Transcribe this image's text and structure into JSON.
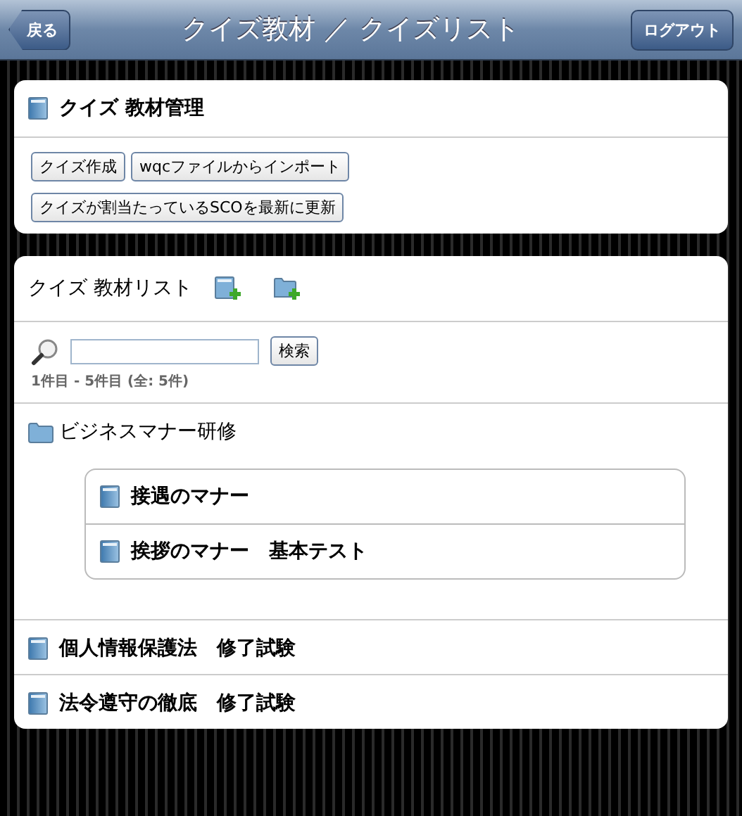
{
  "header": {
    "back": "戻る",
    "title": "クイズ教材 ／ クイズリスト",
    "logout": "ログアウト"
  },
  "management": {
    "title": "クイズ 教材管理",
    "buttons": [
      "クイズ作成",
      "wqcファイルからインポート",
      "クイズが割当たっているSCOを最新に更新"
    ]
  },
  "list": {
    "title": "クイズ 教材リスト",
    "search": {
      "button": "検索"
    },
    "count": "1件目 - 5件目 (全: 5件)",
    "items": [
      {
        "kind": "folder",
        "label": "ビジネスマナー研修",
        "children": [
          {
            "kind": "quiz",
            "label": "接遇のマナー"
          },
          {
            "kind": "quiz",
            "label": "挨拶のマナー　基本テスト"
          }
        ]
      },
      {
        "kind": "quiz",
        "label": "個人情報保護法　修了試験"
      },
      {
        "kind": "quiz",
        "label": "法令遵守の徹底　修了試験"
      }
    ]
  }
}
